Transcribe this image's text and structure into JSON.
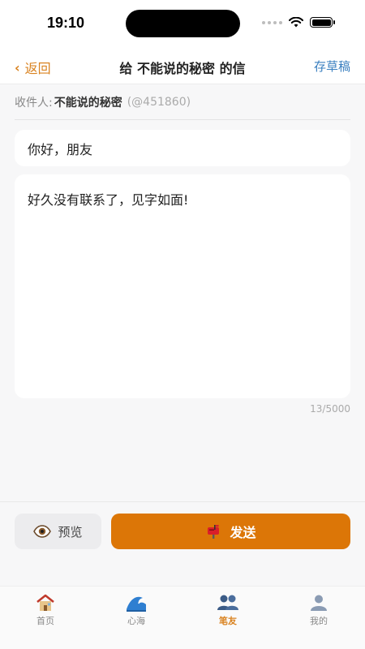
{
  "status": {
    "time": "19:10"
  },
  "nav": {
    "back_label": "返回",
    "title": "给 不能说的秘密 的信",
    "draft_label": "存草稿"
  },
  "recipient": {
    "label": "收件人:",
    "name": "不能说的秘密",
    "id": "(@451860)"
  },
  "letter": {
    "greeting": "你好，朋友",
    "body": "好久没有联系了，见字如面!",
    "char_count": "13/5000"
  },
  "actions": {
    "preview_label": "预览",
    "send_label": "发送",
    "send_color": "#dc7607"
  },
  "tabs": [
    {
      "label": "首页",
      "icon": "home-icon"
    },
    {
      "label": "心海",
      "icon": "wave-icon"
    },
    {
      "label": "笔友",
      "icon": "penpals-icon",
      "active": true
    },
    {
      "label": "我的",
      "icon": "profile-icon"
    }
  ]
}
